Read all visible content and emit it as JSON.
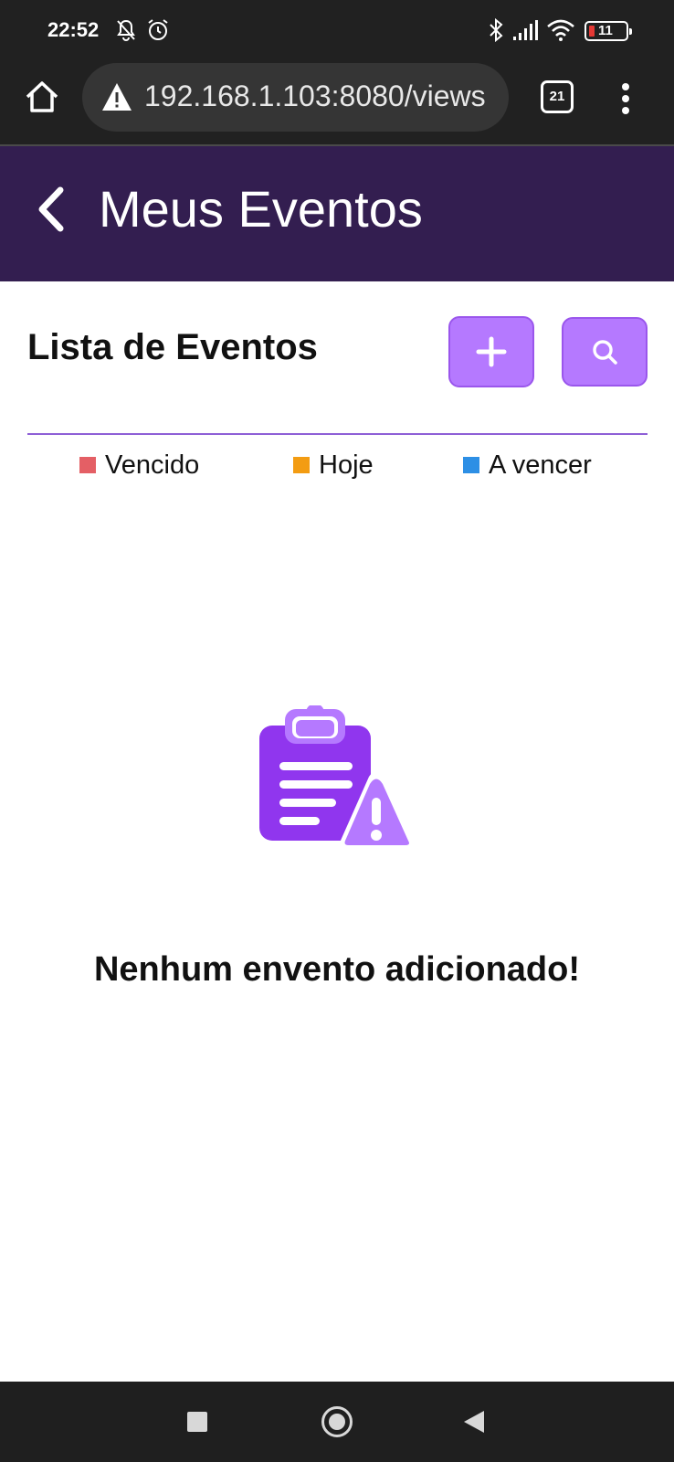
{
  "status_bar": {
    "time": "22:52",
    "battery": "11",
    "icons": [
      "mute-icon",
      "alarm-icon",
      "bluetooth-icon",
      "signal-icon",
      "wifi-icon",
      "battery-icon"
    ]
  },
  "browser": {
    "url": "192.168.1.103:8080/views",
    "tab_count": "21",
    "icons": [
      "home-icon",
      "warning-icon",
      "tabs-icon",
      "more-vert-icon"
    ]
  },
  "header": {
    "title": "Meus Eventos",
    "back_icon": "chevron-left-icon",
    "color": "#331e50"
  },
  "list": {
    "title": "Lista de Eventos",
    "add_icon": "plus-icon",
    "search_icon": "search-icon",
    "accent": "#b579ff"
  },
  "legend": [
    {
      "label": "Vencido",
      "color": "#e45f65"
    },
    {
      "label": "Hoje",
      "color": "#f39c12"
    },
    {
      "label": "A vencer",
      "color": "#2d8fe5"
    }
  ],
  "empty_state": {
    "icon": "clipboard-warning-icon",
    "message": "Nenhum envento adicionado!"
  },
  "nav_bar": {
    "icons": [
      "recents-icon",
      "home-circle-icon",
      "back-triangle-icon"
    ]
  }
}
